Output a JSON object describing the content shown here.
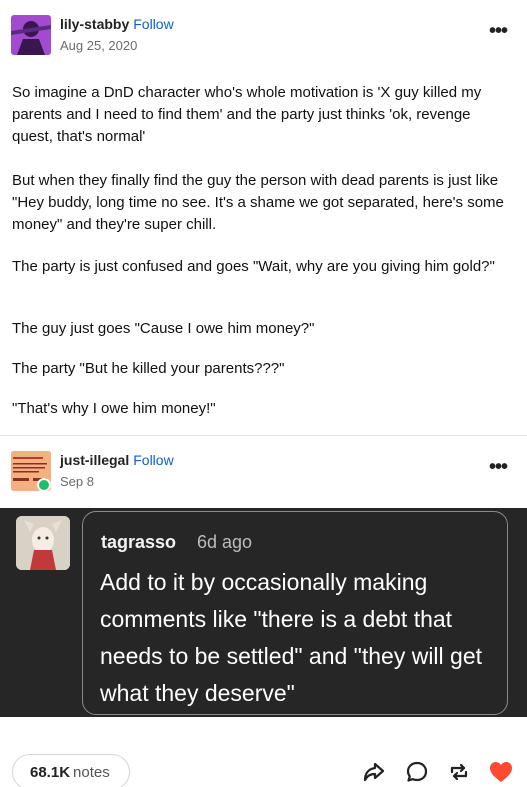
{
  "post": {
    "username": "lily-stabby",
    "follow_label": "Follow",
    "date": "Aug 25, 2020",
    "more_label": "•••",
    "paragraphs": [
      "So imagine a DnD character who's whole motivation is 'X guy killed my parents and I need to find them' and the party just thinks 'ok, revenge quest, that's normal'",
      "But when they finally find the guy the person with dead parents is just like \"Hey buddy, long time no see. It's a shame we got separated, here's some money\" and they're super chill.",
      "The party is just confused and goes \"Wait, why are you giving him gold?\"",
      "The guy just goes \"Cause I owe him money?\"",
      "The party \"But he killed your parents???\"",
      "\"That's why I owe him money!\""
    ]
  },
  "reblog": {
    "username": "just-illegal",
    "follow_label": "Follow",
    "date": "Sep 8",
    "more_label": "•••"
  },
  "comment": {
    "username": "tagrasso",
    "time": "6d ago",
    "text": "Add to it by occasionally making comments like \"there is a debt that needs to be settled\" and \"they will get what they deserve\""
  },
  "footer": {
    "notes_count": "68.1K",
    "notes_label": "notes",
    "icons": [
      "share-icon",
      "reply-icon",
      "reblog-icon",
      "like-heart-icon"
    ],
    "like_color": "#ff4930"
  },
  "colors": {
    "follow_link": "#0b62c5",
    "dark_panel": "#262626"
  }
}
